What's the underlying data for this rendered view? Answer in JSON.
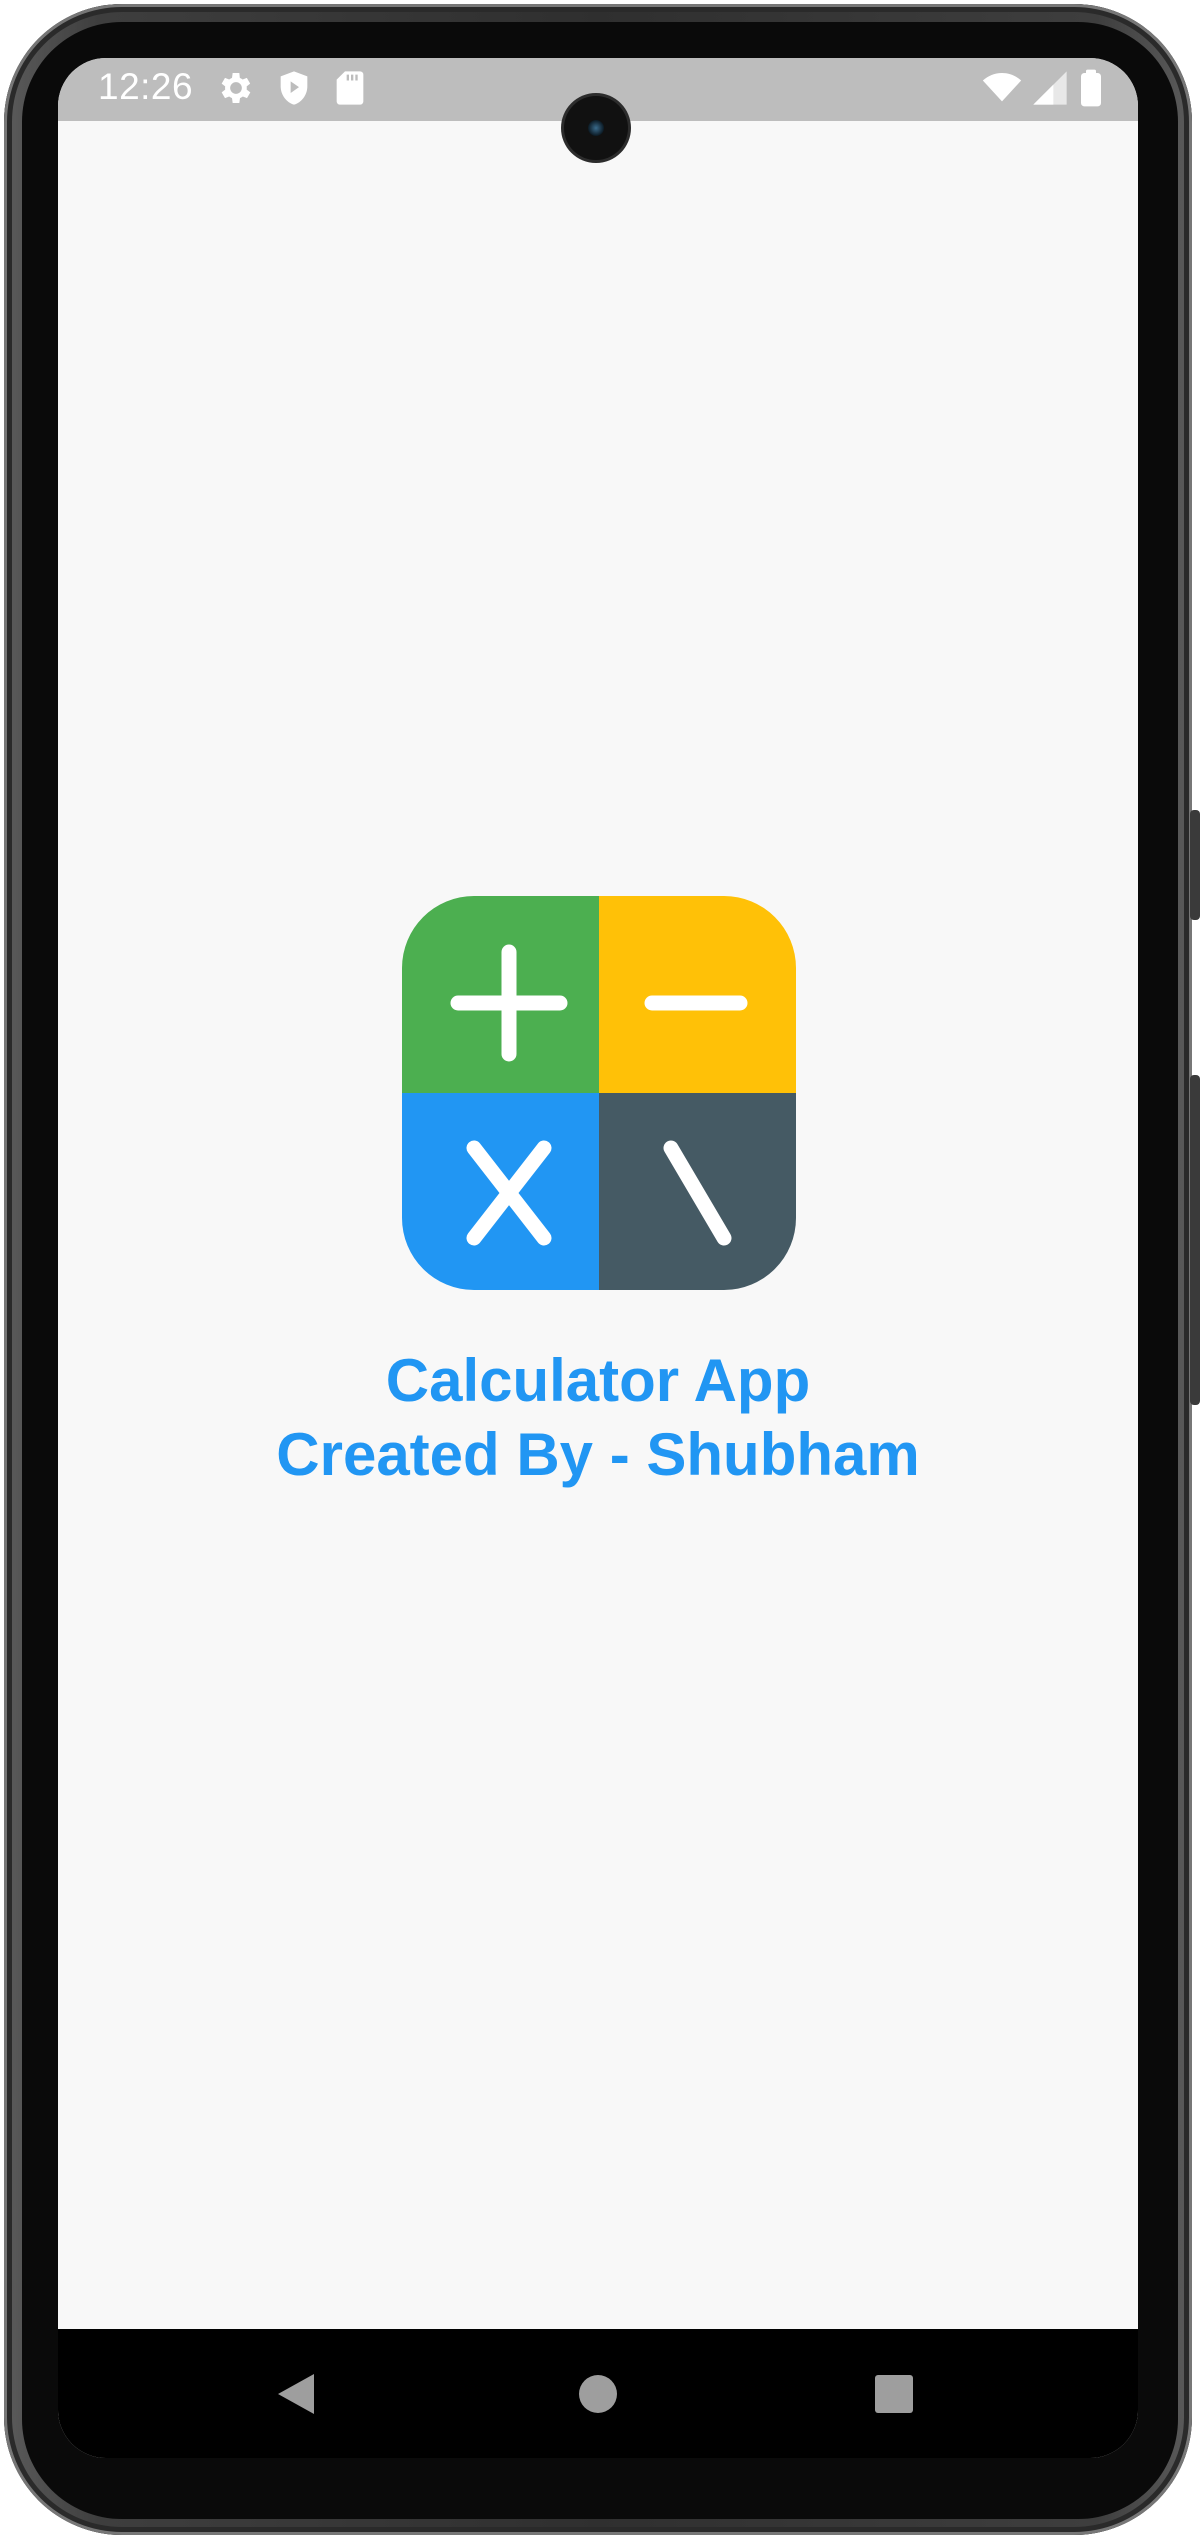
{
  "status_bar": {
    "time": "12:26",
    "left_icons": [
      "settings-icon",
      "play-protect-icon",
      "sd-card-icon"
    ],
    "right_icons": [
      "wifi-icon",
      "cell-signal-icon",
      "battery-icon"
    ]
  },
  "splash": {
    "logo_quadrants": [
      {
        "symbol": "plus",
        "color": "#4caf50"
      },
      {
        "symbol": "minus",
        "color": "#ffc107"
      },
      {
        "symbol": "multiply",
        "color": "#2196f3"
      },
      {
        "symbol": "backslash",
        "color": "#455a64"
      }
    ],
    "title_line1": "Calculator App",
    "title_line2": "Created By - Shubham",
    "text_color": "#2196f3"
  },
  "nav_bar": {
    "buttons": [
      "back-icon",
      "home-icon",
      "recents-icon"
    ]
  }
}
